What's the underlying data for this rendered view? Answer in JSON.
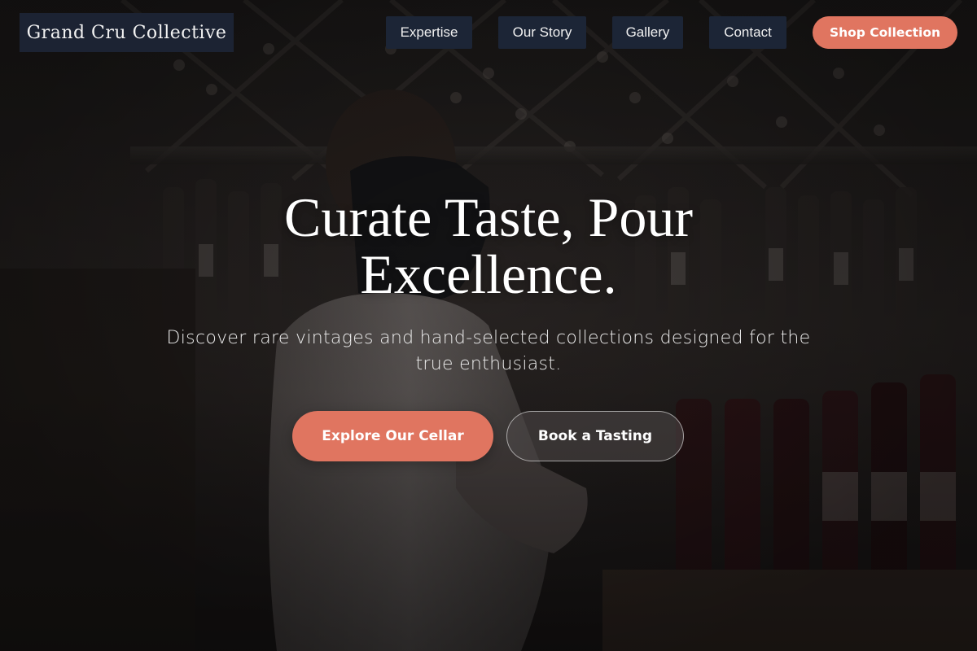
{
  "nav": {
    "brand": "Grand Cru Collective",
    "links": [
      {
        "label": "Expertise"
      },
      {
        "label": "Our Story"
      },
      {
        "label": "Gallery"
      },
      {
        "label": "Contact"
      }
    ],
    "cta": "Shop Collection"
  },
  "hero": {
    "title": "Curate Taste, Pour Excellence.",
    "subtitle": "Discover rare vintages and hand-selected collections designed for the true enthusiast.",
    "primary_button": "Explore Our Cellar",
    "secondary_button": "Book a Tasting"
  },
  "colors": {
    "accent": "#e07560",
    "nav_bg": "#1c2536"
  }
}
